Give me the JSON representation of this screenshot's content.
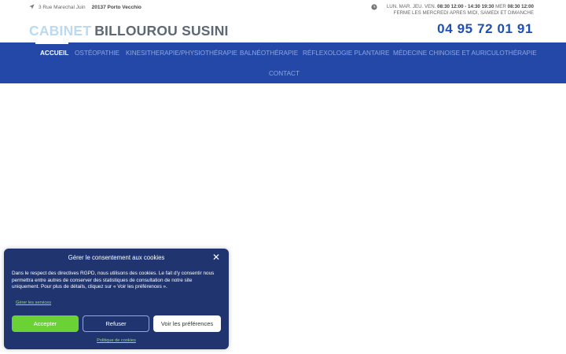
{
  "topbar": {
    "address_icon": "location-arrow-icon",
    "address_street": "3 Rue Marechal Juin",
    "address_city": "20137 Porto Vecchio",
    "clock_icon": "clock-icon",
    "hours_label": "LUN. MAR. JEU. VEN.",
    "hours_times": "08:30 12:00 - 14:30 19:30",
    "hours_wed_label": "MER",
    "hours_wed_times": "08:30 12:00",
    "hours_note": "FERME LES MERCREDI APRES MIDI, SAMEDI ET DIMANCHE"
  },
  "header": {
    "logo_part1": "CABINET",
    "logo_part2": "BILLOUROU SUSINI",
    "phone": "04 95 72 01 91"
  },
  "nav": {
    "items": [
      {
        "label": "ACCUEIL"
      },
      {
        "label": "OSTÉOPATHIE"
      },
      {
        "label": "KINESITHERAPIE/PHYSIOTHÉRAPIE"
      },
      {
        "label": "BALNÉOTHÉRAPIE"
      },
      {
        "label": "RÉFLEXOLOGIE PLANTAIRE"
      },
      {
        "label": "MÉDECINE CHINOISE ET AURICULOTHÉRAPIE"
      },
      {
        "label": "CONTACT"
      }
    ]
  },
  "cookie": {
    "title": "Gérer le consentement aux cookies",
    "close_icon": "close-icon",
    "message": "Dans le respect des directives RGPD, nous utilisons des cookies. Le fait d'y consentir nous permettra entre autres de conserver des statistiques de consultation de notre site uniquement. Pour plus de détails, cliquez sur « Voir les préférences ».",
    "manage_link": "Gérer les services",
    "accept_label": "Accepter",
    "refuse_label": "Refuser",
    "prefs_label": "Voir les préférences",
    "policy_link": "Politique de cookies",
    "colors": {
      "panel": "#20356f",
      "accept": "#6bd235",
      "link": "#8ee36a"
    }
  },
  "colors": {
    "nav": "#2448a8",
    "phone": "#1f4fb4",
    "logo_light": "#bcd9ef",
    "logo_dark": "#5e6874"
  }
}
